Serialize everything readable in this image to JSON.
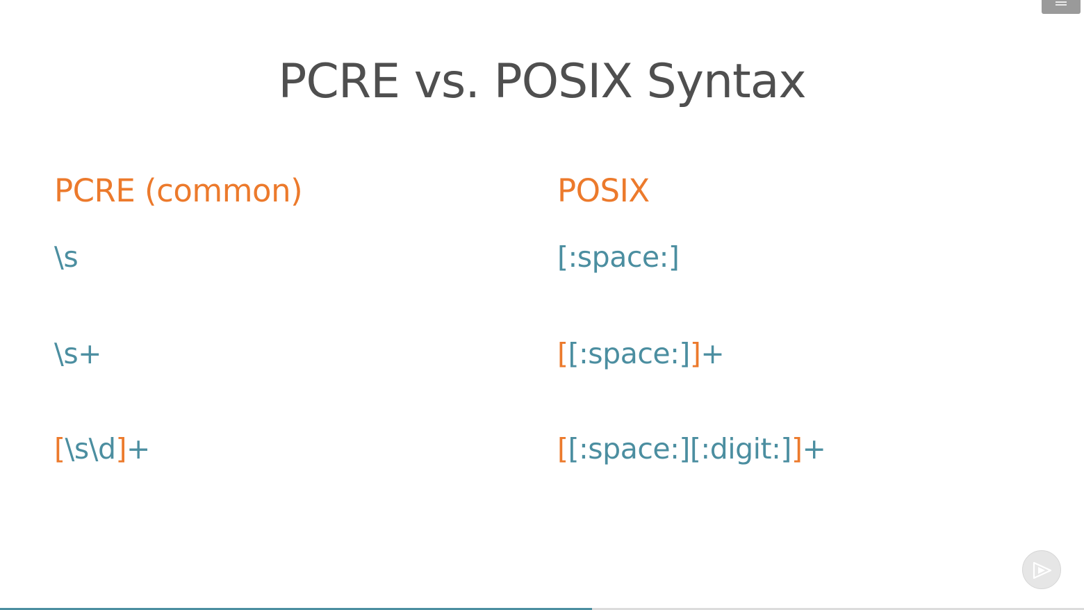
{
  "slide": {
    "title": "PCRE vs. POSIX Syntax",
    "left_heading": "PCRE (common)",
    "right_heading": "POSIX",
    "rows": [
      {
        "pcre": [
          {
            "text": "\\s",
            "accent": false
          }
        ],
        "posix": [
          {
            "text": "[:space:]",
            "accent": false
          }
        ]
      },
      {
        "pcre": [
          {
            "text": "\\s+",
            "accent": false
          }
        ],
        "posix": [
          {
            "text": "[",
            "accent": true
          },
          {
            "text": "[:space:]",
            "accent": false
          },
          {
            "text": "]",
            "accent": true
          },
          {
            "text": "+",
            "accent": false
          }
        ]
      },
      {
        "pcre": [
          {
            "text": "[",
            "accent": true
          },
          {
            "text": "\\s\\d",
            "accent": false
          },
          {
            "text": "]",
            "accent": true
          },
          {
            "text": "+",
            "accent": false
          }
        ],
        "posix": [
          {
            "text": "[",
            "accent": true
          },
          {
            "text": "[:space:][:digit:]",
            "accent": false
          },
          {
            "text": "]",
            "accent": true
          },
          {
            "text": "+",
            "accent": false
          }
        ]
      }
    ]
  },
  "colors": {
    "title": "#4f4f4f",
    "accent": "#ec7a2c",
    "code": "#4b8ea0",
    "progress": "#4b8ea0"
  },
  "controls": {
    "menu_icon": "menu-icon",
    "play_icon": "play-icon"
  },
  "progress": {
    "fraction": 0.546
  }
}
